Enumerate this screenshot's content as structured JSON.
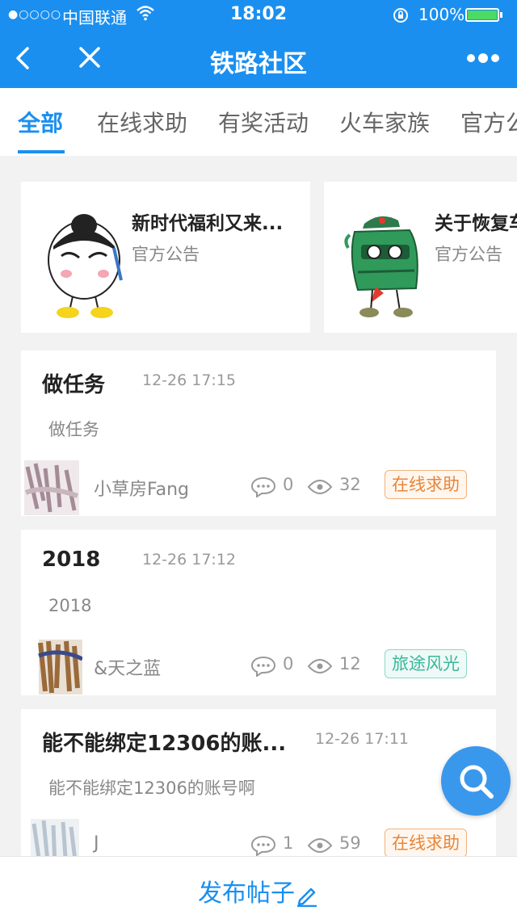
{
  "status_bar": {
    "signal": "●○○○○",
    "carrier": "中国联通",
    "time": "18:02",
    "battery": "100%"
  },
  "nav": {
    "title": "铁路社区"
  },
  "tabs": [
    {
      "label": "全部"
    },
    {
      "label": "在线求助"
    },
    {
      "label": "有奖活动"
    },
    {
      "label": "火车家族"
    },
    {
      "label": "官方公"
    }
  ],
  "notices": [
    {
      "title": "新时代福利又来...",
      "subtitle": "官方公告"
    },
    {
      "title": "关于恢复车",
      "subtitle": "官方公告"
    }
  ],
  "posts": [
    {
      "title": "做任务",
      "time": "12-26 17:15",
      "body": "做任务",
      "author": "小草房Fang",
      "comments": "0",
      "views": "32",
      "tag": "在线求助"
    },
    {
      "title": "2018",
      "time": "12-26 17:12",
      "body": "2018",
      "author": "&天之蓝",
      "comments": "0",
      "views": "12",
      "tag": "旅途风光"
    },
    {
      "title": "能不能绑定12306的账...",
      "time": "12-26 17:11",
      "body": "能不能绑定12306的账号啊",
      "author": "J",
      "comments": "1",
      "views": "59",
      "tag": "在线求助"
    }
  ],
  "bottom": {
    "publish_label": "发布帖子"
  },
  "colors": {
    "brand": "#1a8ff0",
    "tag_orange": "#e8863a",
    "tag_green": "#3bb59a"
  },
  "icons": [
    "back-icon",
    "close-icon",
    "more-icon",
    "comment-icon",
    "eye-icon",
    "search-icon",
    "pencil-icon",
    "wifi-icon",
    "lock-rotation-icon",
    "battery-icon"
  ]
}
